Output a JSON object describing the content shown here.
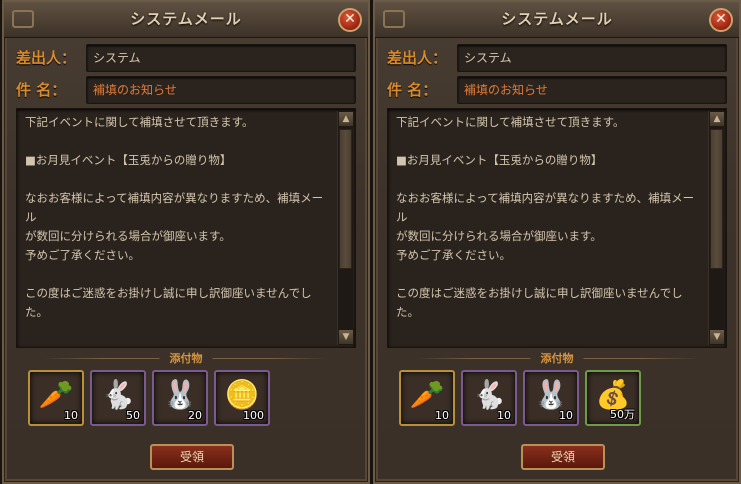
{
  "panels": [
    {
      "title": "システムメール",
      "close_label": "✕",
      "sender_label": "差出人：",
      "sender_value": "システム",
      "subject_label": "件 名：",
      "subject_value": "補填のお知らせ",
      "body": "下記イベントに関して補填させて頂きます。\n\n■お月見イベント【玉兎からの贈り物】\n\nなおお客様によって補填内容が異なりますため、補填メール\nが数回に分けられる場合が御座います。\n予めご了承ください。\n\nこの度はご迷惑をお掛けし誠に申し訳御座いませんでした。",
      "attachments_label": "添付物",
      "items": [
        {
          "icon": "carrot-icon",
          "count": "10"
        },
        {
          "icon": "golden-rabbit-figure-icon",
          "count": "50"
        },
        {
          "icon": "white-rabbit-icon",
          "count": "20"
        },
        {
          "icon": "gold-ingot-icon",
          "count": "100"
        }
      ],
      "button_label": "受領"
    },
    {
      "title": "システムメール",
      "close_label": "✕",
      "sender_label": "差出人：",
      "sender_value": "システム",
      "subject_label": "件 名：",
      "subject_value": "補填のお知らせ",
      "body": "下記イベントに関して補填させて頂きます。\n\n■お月見イベント【玉兎からの贈り物】\n\nなおお客様によって補填内容が異なりますため、補填メール\nが数回に分けられる場合が御座います。\n予めご了承ください。\n\nこの度はご迷惑をお掛けし誠に申し訳御座いませんでした。",
      "attachments_label": "添付物",
      "items": [
        {
          "icon": "carrot-icon",
          "count": "10"
        },
        {
          "icon": "golden-rabbit-figure-icon",
          "count": "10"
        },
        {
          "icon": "white-rabbit-icon",
          "count": "10"
        },
        {
          "icon": "money-bag-icon",
          "count": "50万"
        }
      ],
      "button_label": "受領"
    }
  ]
}
